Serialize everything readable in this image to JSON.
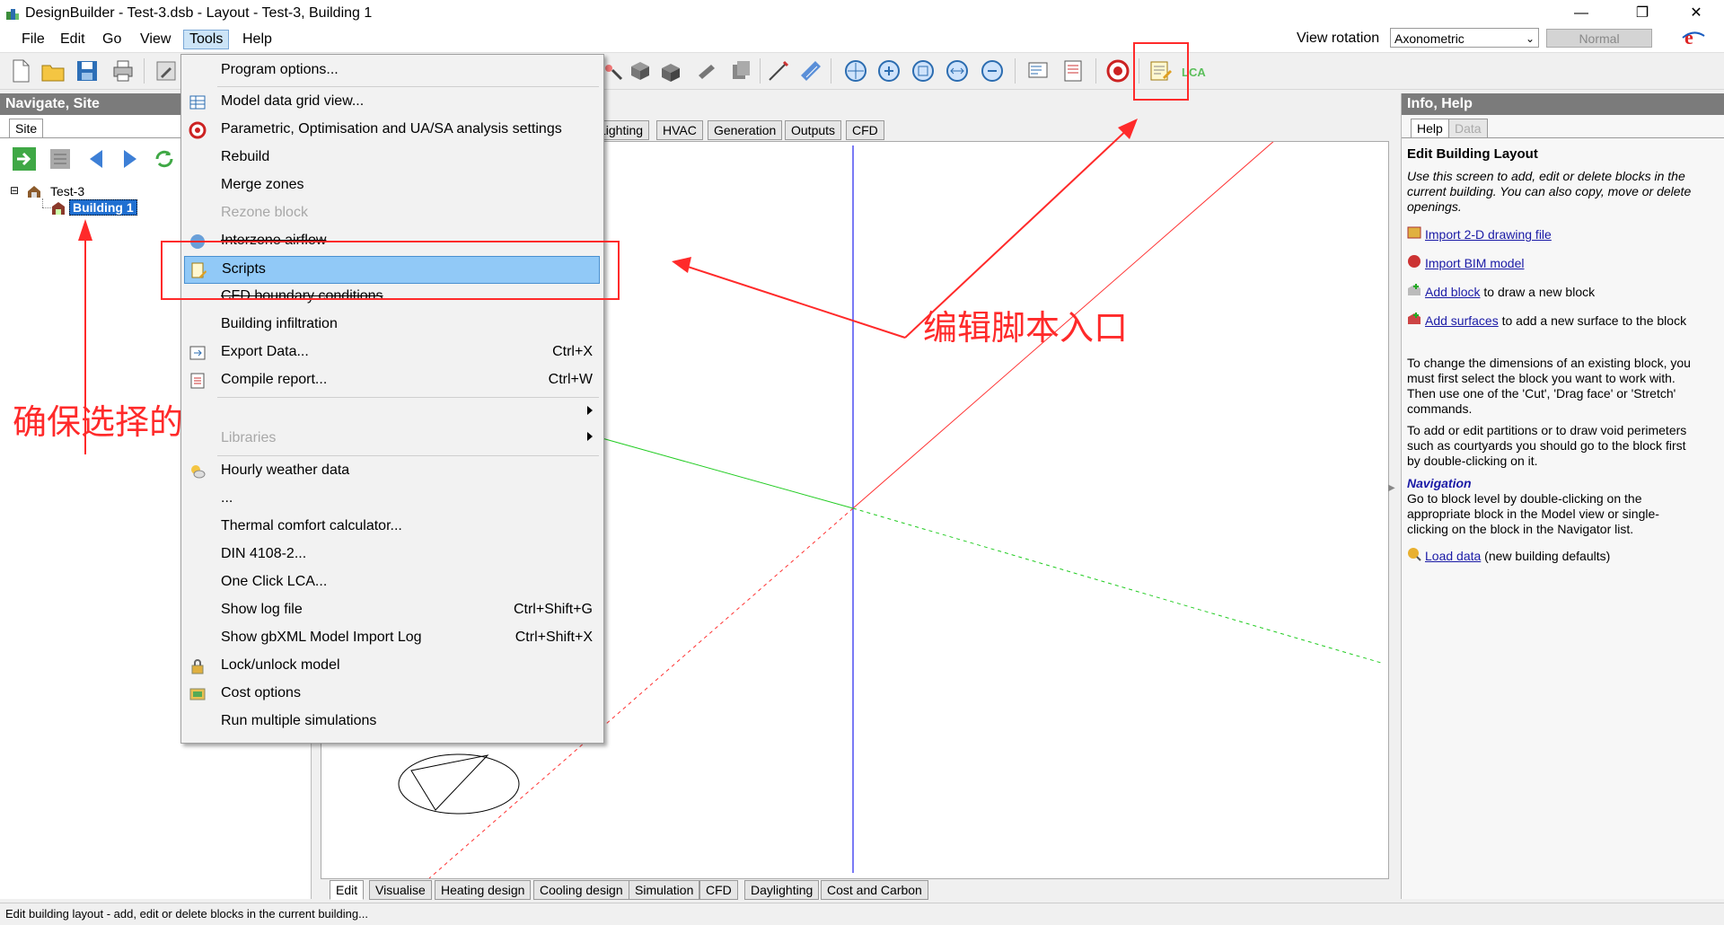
{
  "window": {
    "title": "DesignBuilder - Test-3.dsb - Layout - Test-3, Building 1",
    "minimize": "—",
    "restore": "❐",
    "close": "✕"
  },
  "menubar": [
    "File",
    "Edit",
    "Go",
    "View",
    "Tools",
    "Help"
  ],
  "view_rotation": {
    "label": "View rotation",
    "value": "Axonometric",
    "normal_button": "Normal"
  },
  "left_panel": {
    "header": "Navigate, Site",
    "tab": "Site",
    "tree": {
      "root": "Test-3",
      "child": "Building 1",
      "expander": "⊟"
    }
  },
  "viewport_tabs_top": [
    "Lighting",
    "HVAC",
    "Generation",
    "Outputs",
    "CFD"
  ],
  "viewport_tabs_bottom": [
    "Edit",
    "Visualise",
    "Heating design",
    "Cooling design",
    "Simulation",
    "CFD",
    "Daylighting",
    "Cost and Carbon"
  ],
  "tools_menu": {
    "items": [
      {
        "label": "Program options...",
        "shortcut": "",
        "icon": "",
        "disabled": false
      },
      {
        "label": "Model data grid view...",
        "shortcut": "",
        "icon": "grid-icon",
        "disabled": false
      },
      {
        "label": "Parametric, Optimisation and UA/SA analysis settings",
        "shortcut": "",
        "icon": "target-icon",
        "disabled": false
      },
      {
        "label": "Rebuild",
        "shortcut": "",
        "icon": "",
        "disabled": false
      },
      {
        "label": "Merge zones",
        "shortcut": "",
        "icon": "",
        "disabled": false
      },
      {
        "label": "Rezone block",
        "shortcut": "",
        "icon": "",
        "disabled": true
      },
      {
        "label": "Interzone airflow",
        "shortcut": "",
        "icon": "airflow-icon",
        "disabled": false
      },
      {
        "label": "Scripts",
        "shortcut": "",
        "icon": "script-icon",
        "disabled": false
      },
      {
        "label": "CFD boundary conditions",
        "shortcut": "",
        "icon": "",
        "disabled": false
      },
      {
        "label": "Building infiltration",
        "shortcut": "",
        "icon": "",
        "disabled": false
      },
      {
        "label": "Export Data...",
        "shortcut": "Ctrl+X",
        "icon": "export-icon",
        "disabled": false
      },
      {
        "label": "Compile report...",
        "shortcut": "Ctrl+W",
        "icon": "report-icon",
        "disabled": false
      },
      {
        "label": "Libraries",
        "shortcut": "",
        "icon": "",
        "disabled": true
      },
      {
        "label": "Hourly weather data",
        "shortcut": "",
        "icon": "weather-icon",
        "disabled": false
      },
      {
        "label": "...",
        "shortcut": "",
        "icon": "",
        "disabled": false
      },
      {
        "label": "Thermal comfort calculator...",
        "shortcut": "",
        "icon": "",
        "disabled": false
      },
      {
        "label": "DIN 4108-2...",
        "shortcut": "",
        "icon": "",
        "disabled": false
      },
      {
        "label": "One Click LCA...",
        "shortcut": "",
        "icon": "",
        "disabled": false
      },
      {
        "label": "Show log file",
        "shortcut": "Ctrl+Shift+G",
        "icon": "",
        "disabled": false
      },
      {
        "label": "Show gbXML Model Import Log",
        "shortcut": "Ctrl+Shift+X",
        "icon": "",
        "disabled": false
      },
      {
        "label": "Lock/unlock model",
        "shortcut": "",
        "icon": "lock-icon",
        "disabled": false
      },
      {
        "label": "Cost options",
        "shortcut": "",
        "icon": "cost-icon",
        "disabled": false
      },
      {
        "label": "Run multiple simulations",
        "shortcut": "",
        "icon": "",
        "disabled": false
      }
    ]
  },
  "right_panel": {
    "header": "Info, Help",
    "tabs": [
      "Help",
      "Data"
    ],
    "title": "Edit Building Layout",
    "intro": "Use this screen to add, edit or delete blocks in the current building. You can also copy, move or delete openings.",
    "links": [
      {
        "link": "Import 2-D drawing file",
        "rest": ""
      },
      {
        "link": "Import BIM model",
        "rest": ""
      },
      {
        "link": "Add block",
        "rest": " to draw a new block"
      },
      {
        "link": "Add surfaces",
        "rest": " to add a new surface to the block"
      }
    ],
    "para1": "To change the dimensions of an existing block, you must first select the block you want to work with. Then use one of the 'Cut', 'Drag face' or 'Stretch' commands.",
    "para2": "To add or edit partitions or to draw void perimeters such as courtyards you should go to the block first by double-clicking on it.",
    "nav_title": "Navigation",
    "nav_text": "Go to block level by double-clicking on the appropriate block in the Model view or single-clicking on the block in the Navigator list.",
    "load_link": "Load data",
    "load_rest": " (new building defaults)"
  },
  "statusbar": "Edit building layout - add, edit or delete blocks in the current building...",
  "annotations": {
    "left": "确保选择的是building",
    "right": "编辑脚本入口"
  },
  "colors": {
    "panel_header": "#7b7b7b",
    "menu_highlight": "#91c9f7",
    "annotation_red": "#ff2a2a",
    "axis_x": "#ff3333",
    "axis_y": "#22cc22",
    "axis_z": "#2222ee"
  }
}
